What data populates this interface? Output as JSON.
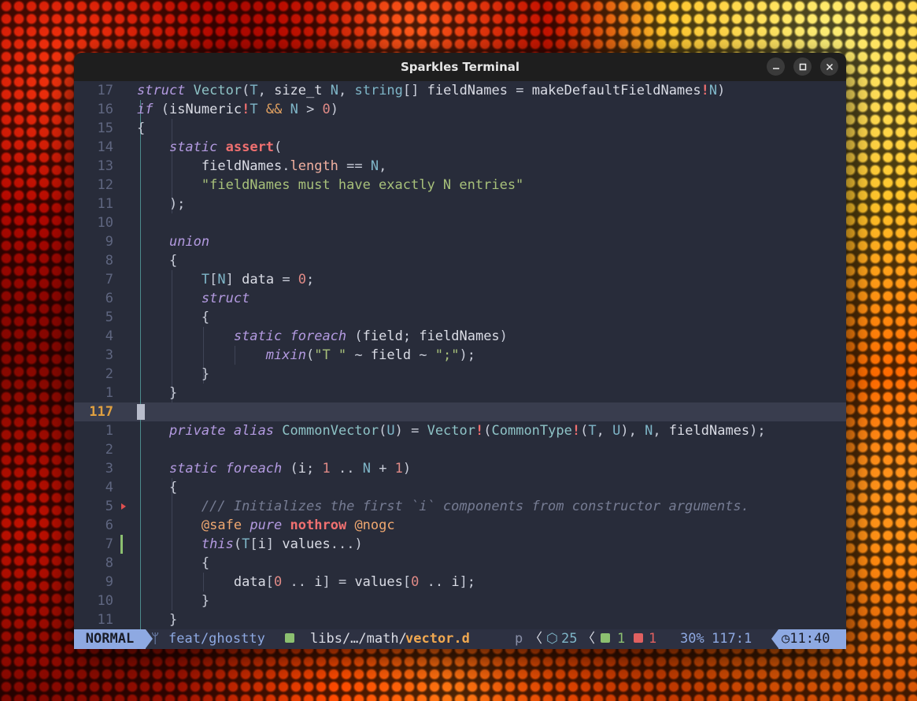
{
  "window": {
    "title": "Sparkles Terminal"
  },
  "editor": {
    "current_line": "117",
    "rows": [
      {
        "ln": "17",
        "segs": [
          [
            "k",
            "struct"
          ],
          [
            "p",
            " "
          ],
          [
            "ty",
            "Vector"
          ],
          [
            "p",
            "("
          ],
          [
            "t",
            "T"
          ],
          [
            "p",
            ", "
          ],
          [
            "v",
            "size_t"
          ],
          [
            "p",
            " "
          ],
          [
            "t",
            "N"
          ],
          [
            "p",
            ", "
          ],
          [
            "t",
            "string"
          ],
          [
            "p",
            "[] "
          ],
          [
            "v",
            "fieldNames"
          ],
          [
            "p",
            " = "
          ],
          [
            "v",
            "makeDefaultFieldNames"
          ],
          [
            "a",
            "!"
          ],
          [
            "t",
            "N"
          ],
          [
            "p",
            ")"
          ]
        ]
      },
      {
        "ln": "16",
        "segs": [
          [
            "k",
            "if"
          ],
          [
            "p",
            " ("
          ],
          [
            "v",
            "isNumeric"
          ],
          [
            "a",
            "!"
          ],
          [
            "t",
            "T"
          ],
          [
            "p",
            " "
          ],
          [
            "op",
            "&&"
          ],
          [
            "p",
            " "
          ],
          [
            "t",
            "N"
          ],
          [
            "p",
            " > "
          ],
          [
            "n",
            "0"
          ],
          [
            "p",
            ")"
          ]
        ]
      },
      {
        "ln": "15",
        "segs": [
          [
            "p",
            "{"
          ]
        ]
      },
      {
        "ln": "14",
        "segs": [
          [
            "p",
            "    "
          ],
          [
            "k",
            "static"
          ],
          [
            "p",
            " "
          ],
          [
            "a",
            "assert"
          ],
          [
            "p",
            "("
          ]
        ]
      },
      {
        "ln": "13",
        "segs": [
          [
            "p",
            "        "
          ],
          [
            "v",
            "fieldNames"
          ],
          [
            "p",
            "."
          ],
          [
            "m",
            "length"
          ],
          [
            "p",
            " == "
          ],
          [
            "t",
            "N"
          ],
          [
            "p",
            ","
          ]
        ]
      },
      {
        "ln": "12",
        "segs": [
          [
            "p",
            "        "
          ],
          [
            "s",
            "\"fieldNames must have exactly N entries\""
          ]
        ]
      },
      {
        "ln": "11",
        "segs": [
          [
            "p",
            "    );"
          ]
        ]
      },
      {
        "ln": "10",
        "segs": []
      },
      {
        "ln": "9",
        "segs": [
          [
            "p",
            "    "
          ],
          [
            "k",
            "union"
          ]
        ]
      },
      {
        "ln": "8",
        "segs": [
          [
            "p",
            "    {"
          ]
        ]
      },
      {
        "ln": "7",
        "segs": [
          [
            "p",
            "        "
          ],
          [
            "t",
            "T"
          ],
          [
            "p",
            "["
          ],
          [
            "t",
            "N"
          ],
          [
            "p",
            "] "
          ],
          [
            "v",
            "data"
          ],
          [
            "p",
            " = "
          ],
          [
            "n",
            "0"
          ],
          [
            "p",
            ";"
          ]
        ]
      },
      {
        "ln": "6",
        "segs": [
          [
            "p",
            "        "
          ],
          [
            "k",
            "struct"
          ]
        ]
      },
      {
        "ln": "5",
        "segs": [
          [
            "p",
            "        {"
          ]
        ]
      },
      {
        "ln": "4",
        "segs": [
          [
            "p",
            "            "
          ],
          [
            "k",
            "static"
          ],
          [
            "p",
            " "
          ],
          [
            "k",
            "foreach"
          ],
          [
            "p",
            " ("
          ],
          [
            "v",
            "field"
          ],
          [
            "p",
            "; "
          ],
          [
            "v",
            "fieldNames"
          ],
          [
            "p",
            ")"
          ]
        ]
      },
      {
        "ln": "3",
        "segs": [
          [
            "p",
            "                "
          ],
          [
            "k",
            "mixin"
          ],
          [
            "p",
            "("
          ],
          [
            "s",
            "\"T \""
          ],
          [
            "p",
            " ~ "
          ],
          [
            "v",
            "field"
          ],
          [
            "p",
            " ~ "
          ],
          [
            "s",
            "\";\""
          ],
          [
            "p",
            ");"
          ]
        ]
      },
      {
        "ln": "2",
        "segs": [
          [
            "p",
            "        }"
          ]
        ]
      },
      {
        "ln": "1",
        "segs": [
          [
            "p",
            "    }"
          ]
        ]
      },
      {
        "ln": "117",
        "segs": []
      },
      {
        "ln": "1",
        "segs": [
          [
            "p",
            "    "
          ],
          [
            "k",
            "private"
          ],
          [
            "p",
            " "
          ],
          [
            "k",
            "alias"
          ],
          [
            "p",
            " "
          ],
          [
            "ty",
            "CommonVector"
          ],
          [
            "p",
            "("
          ],
          [
            "t",
            "U"
          ],
          [
            "p",
            ") = "
          ],
          [
            "ty",
            "Vector"
          ],
          [
            "a",
            "!"
          ],
          [
            "p",
            "("
          ],
          [
            "ty",
            "CommonType"
          ],
          [
            "a",
            "!"
          ],
          [
            "p",
            "("
          ],
          [
            "t",
            "T"
          ],
          [
            "p",
            ", "
          ],
          [
            "t",
            "U"
          ],
          [
            "p",
            "), "
          ],
          [
            "t",
            "N"
          ],
          [
            "p",
            ", "
          ],
          [
            "v",
            "fieldNames"
          ],
          [
            "p",
            ");"
          ]
        ]
      },
      {
        "ln": "2",
        "segs": []
      },
      {
        "ln": "3",
        "segs": [
          [
            "p",
            "    "
          ],
          [
            "k",
            "static"
          ],
          [
            "p",
            " "
          ],
          [
            "k",
            "foreach"
          ],
          [
            "p",
            " ("
          ],
          [
            "v",
            "i"
          ],
          [
            "p",
            "; "
          ],
          [
            "n",
            "1"
          ],
          [
            "p",
            " .. "
          ],
          [
            "t",
            "N"
          ],
          [
            "p",
            " + "
          ],
          [
            "n",
            "1"
          ],
          [
            "p",
            ")"
          ]
        ]
      },
      {
        "ln": "4",
        "segs": [
          [
            "p",
            "    {"
          ]
        ]
      },
      {
        "ln": "5",
        "segs": [
          [
            "p",
            "        "
          ],
          [
            "c",
            "/// Initializes the first `i` components from constructor arguments."
          ]
        ]
      },
      {
        "ln": "6",
        "segs": [
          [
            "p",
            "        "
          ],
          [
            "at",
            "@safe"
          ],
          [
            "p",
            " "
          ],
          [
            "k",
            "pure"
          ],
          [
            "p",
            " "
          ],
          [
            "a",
            "nothrow"
          ],
          [
            "p",
            " "
          ],
          [
            "at",
            "@nogc"
          ]
        ]
      },
      {
        "ln": "7",
        "segs": [
          [
            "p",
            "        "
          ],
          [
            "k",
            "this"
          ],
          [
            "p",
            "("
          ],
          [
            "t",
            "T"
          ],
          [
            "p",
            "["
          ],
          [
            "v",
            "i"
          ],
          [
            "p",
            "] "
          ],
          [
            "v",
            "values"
          ],
          [
            "p",
            "...)"
          ]
        ]
      },
      {
        "ln": "8",
        "segs": [
          [
            "p",
            "        {"
          ]
        ]
      },
      {
        "ln": "9",
        "segs": [
          [
            "p",
            "            "
          ],
          [
            "v",
            "data"
          ],
          [
            "p",
            "["
          ],
          [
            "n",
            "0"
          ],
          [
            "p",
            " .. "
          ],
          [
            "v",
            "i"
          ],
          [
            "p",
            "] = "
          ],
          [
            "v",
            "values"
          ],
          [
            "p",
            "["
          ],
          [
            "n",
            "0"
          ],
          [
            "p",
            " .. "
          ],
          [
            "v",
            "i"
          ],
          [
            "p",
            "];"
          ]
        ]
      },
      {
        "ln": "10",
        "segs": [
          [
            "p",
            "        }"
          ]
        ]
      },
      {
        "ln": "11",
        "segs": [
          [
            "p",
            "    }"
          ]
        ]
      }
    ]
  },
  "status": {
    "mode": "NORMAL",
    "branch": "feat/ghostty",
    "path_prefix": "libs/…/math/",
    "file": "vector.d",
    "p": "p",
    "symbols": "25",
    "added": "1",
    "removed": "1",
    "percent": "30%",
    "position": "117:1",
    "time": "11:40"
  }
}
